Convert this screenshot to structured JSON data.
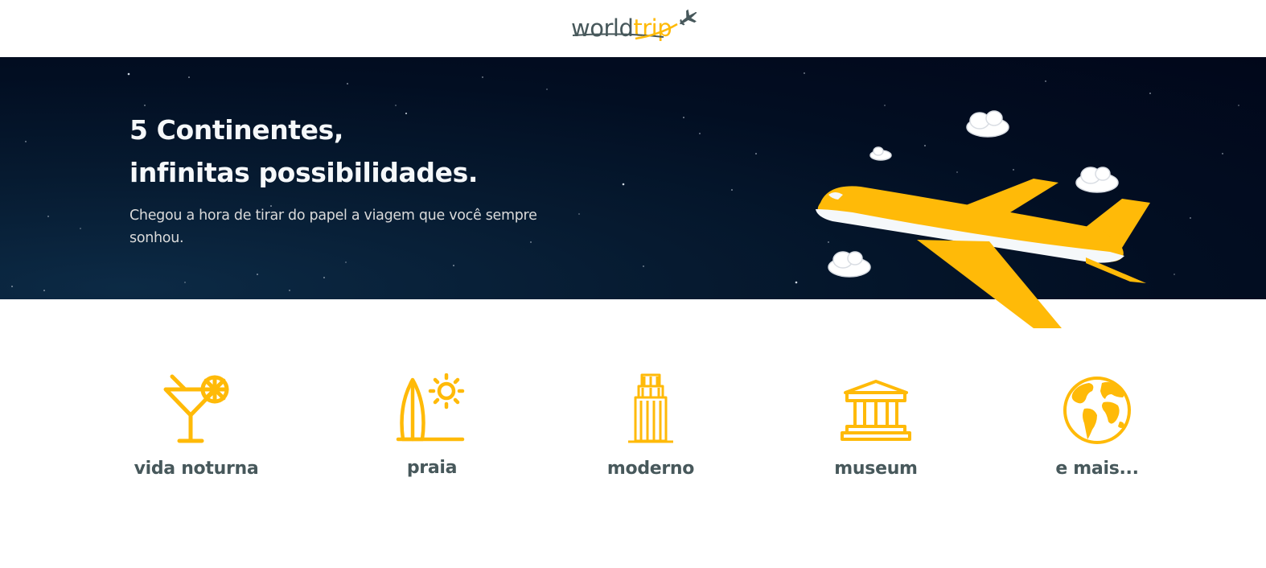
{
  "header": {
    "logo": {
      "world": "world",
      "trip": "trip"
    }
  },
  "banner": {
    "title_line1": "5 Continentes,",
    "title_line2": "infinitas possibilidades.",
    "subtitle": "Chegou a hora de tirar do papel a viagem que você sempre sonhou."
  },
  "travel_types": [
    {
      "label": "vida noturna",
      "icon": "cocktail-icon"
    },
    {
      "label": "praia",
      "icon": "surf-sun-icon"
    },
    {
      "label": "moderno",
      "icon": "skyscraper-icon"
    },
    {
      "label": "museum",
      "icon": "museum-icon"
    },
    {
      "label": "e mais...",
      "icon": "globe-icon"
    }
  ],
  "colors": {
    "highlight": "#FFBA08",
    "dark_text": "#47585B",
    "light_text": "#F5F8FA",
    "banner_bg": "#020e22"
  }
}
